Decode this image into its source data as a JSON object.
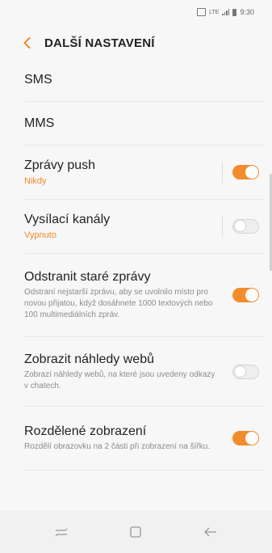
{
  "status_bar": {
    "time": "9:30",
    "network": "LTE"
  },
  "header": {
    "title": "DALŠÍ NASTAVENÍ"
  },
  "simple_items": [
    {
      "label": "SMS"
    },
    {
      "label": "MMS"
    }
  ],
  "settings": [
    {
      "title": "Zprávy push",
      "subtitle": "Nikdy",
      "enabled": true,
      "has_divider": true
    },
    {
      "title": "Vysílací kanály",
      "subtitle": "Vypnuto",
      "enabled": false,
      "has_divider": true
    },
    {
      "title": "Odstranit staré zprávy",
      "description": "Odstraní nejstarší zprávu, aby se uvolnilo místo pro novou přijatou, když dosáhnete 1000 textových nebo 100 multimediálních zpráv.",
      "enabled": true,
      "has_divider": false
    },
    {
      "title": "Zobrazit náhledy webů",
      "description": "Zobrazí náhledy webů, na které jsou uvedeny odkazy v chatech.",
      "enabled": false,
      "has_divider": false
    },
    {
      "title": "Rozdělené zobrazení",
      "description": "Rozdělí obrazovku na 2 části při zobrazení na šířku.",
      "enabled": true,
      "has_divider": false
    }
  ],
  "colors": {
    "accent": "#f18c2d",
    "background": "#f7f7f7"
  },
  "nav_bar": {
    "icons": [
      "recent-apps-icon",
      "home-icon",
      "back-icon"
    ]
  }
}
